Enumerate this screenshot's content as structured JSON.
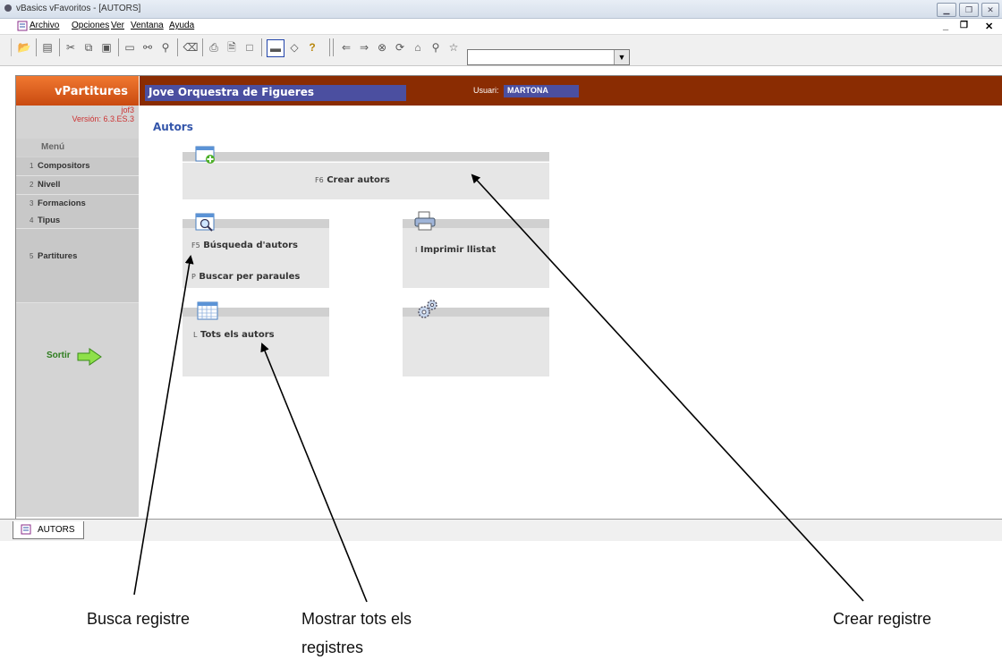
{
  "window": {
    "title": "vBasics vFavoritos - [AUTORS]"
  },
  "menubar": {
    "items": [
      "Archivo",
      "Opciones",
      "Ver",
      "Ventana",
      "Ayuda"
    ]
  },
  "toolbar": {
    "combo_value": ""
  },
  "sidebar": {
    "app_name": "vPartitures",
    "user_code": "jof3",
    "version": "Versión: 6.3.ES.3",
    "menu_heading": "Menú",
    "items": [
      {
        "num": "1",
        "label": "Compositors"
      },
      {
        "num": "2",
        "label": "Nivell"
      },
      {
        "num": "3",
        "label": "Formacions"
      },
      {
        "num": "4",
        "label": "Tipus"
      },
      {
        "num": "5",
        "label": "Partitures"
      }
    ],
    "exit_label": "Sortir"
  },
  "header": {
    "org_name": "Jove Orquestra de Figueres",
    "user_label": "Usuari:",
    "user_value": "MARTONA"
  },
  "main": {
    "page_title": "Autors",
    "panels": {
      "create": {
        "key": "F6",
        "label": "Crear autors"
      },
      "search": {
        "key": "F5",
        "label": "Búsqueda d'autors",
        "key2": "P",
        "label2": "Buscar per paraules"
      },
      "print": {
        "key": "I",
        "label": "Imprimir llistat"
      },
      "all": {
        "key": "L",
        "label": "Tots els autors"
      }
    }
  },
  "taskbar": {
    "tab_label": "AUTORS"
  },
  "annotations": {
    "busca": "Busca  registre",
    "mostrar_line1": "Mostrar tots els",
    "mostrar_line2": "registres",
    "crear": "Crear registre"
  }
}
